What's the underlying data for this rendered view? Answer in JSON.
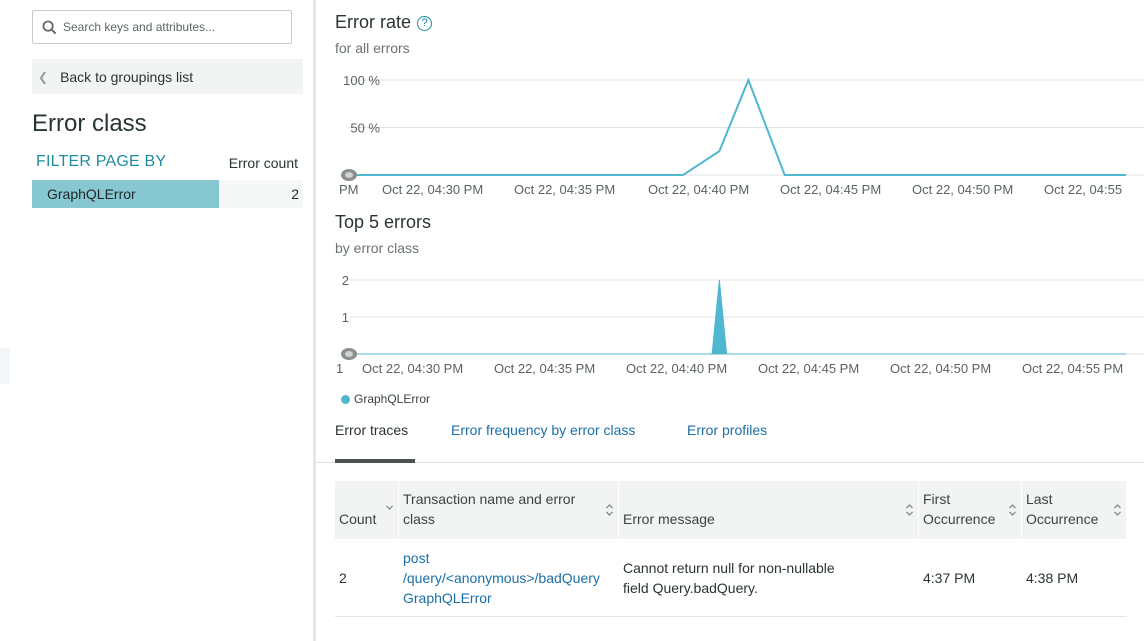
{
  "sidebar": {
    "search_placeholder": "Search keys and attributes...",
    "back_label": "Back to groupings list",
    "title": "Error class",
    "filter_heading": "FILTER PAGE BY",
    "count_heading": "Error count",
    "groups": [
      {
        "label": "GraphQLError",
        "count": "2"
      }
    ]
  },
  "colors": {
    "accent": "#1d8ca0",
    "series": "#4fb7d0",
    "bar_fill": "#86c7d1",
    "link": "#1b6fa8"
  },
  "error_rate": {
    "title": "Error rate",
    "subtitle": "for all errors",
    "chart_data": {
      "type": "line",
      "y_ticks": [
        "100 %",
        "50 %"
      ],
      "x_ticks": [
        "PM",
        "Oct 22, 04:30 PM",
        "Oct 22, 04:35 PM",
        "Oct 22, 04:40 PM",
        "Oct 22, 04:45 PM",
        "Oct 22, 04:50 PM",
        "Oct 22, 04:55"
      ],
      "x": [
        0,
        21,
        46,
        51,
        55,
        60,
        107
      ],
      "values": [
        0,
        0,
        0,
        25,
        100,
        0,
        0
      ],
      "ylim": [
        0,
        100
      ]
    }
  },
  "top_errors": {
    "title": "Top 5 errors",
    "subtitle": "by error class",
    "chart_data": {
      "type": "area",
      "y_ticks": [
        "2",
        "1"
      ],
      "x_ticks": [
        "1",
        "Oct 22, 04:30 PM",
        "Oct 22, 04:35 PM",
        "Oct 22, 04:40 PM",
        "Oct 22, 04:45 PM",
        "Oct 22, 04:50 PM",
        "Oct 22, 04:55 PM"
      ],
      "series": [
        {
          "name": "GraphQLError",
          "x": [
            0,
            50,
            51,
            52,
            107
          ],
          "values": [
            0,
            0,
            2,
            0,
            0
          ]
        }
      ],
      "ylim": [
        0,
        2
      ]
    },
    "legend": "GraphQLError"
  },
  "tabs": [
    {
      "label": "Error traces",
      "active": true
    },
    {
      "label": "Error frequency by error class",
      "active": false
    },
    {
      "label": "Error profiles",
      "active": false
    }
  ],
  "table": {
    "headers": [
      "Count",
      "Transaction name and error class",
      "Error message",
      "First Occurrence",
      "Last Occurrence"
    ],
    "rows": [
      {
        "count": "2",
        "txn_name": "post /query/<anonymous>/badQuery",
        "error_class": "GraphQLError",
        "message": "Cannot return null for non-nullable field Query.badQuery.",
        "first": "4:37 PM",
        "last": "4:38 PM"
      }
    ]
  }
}
